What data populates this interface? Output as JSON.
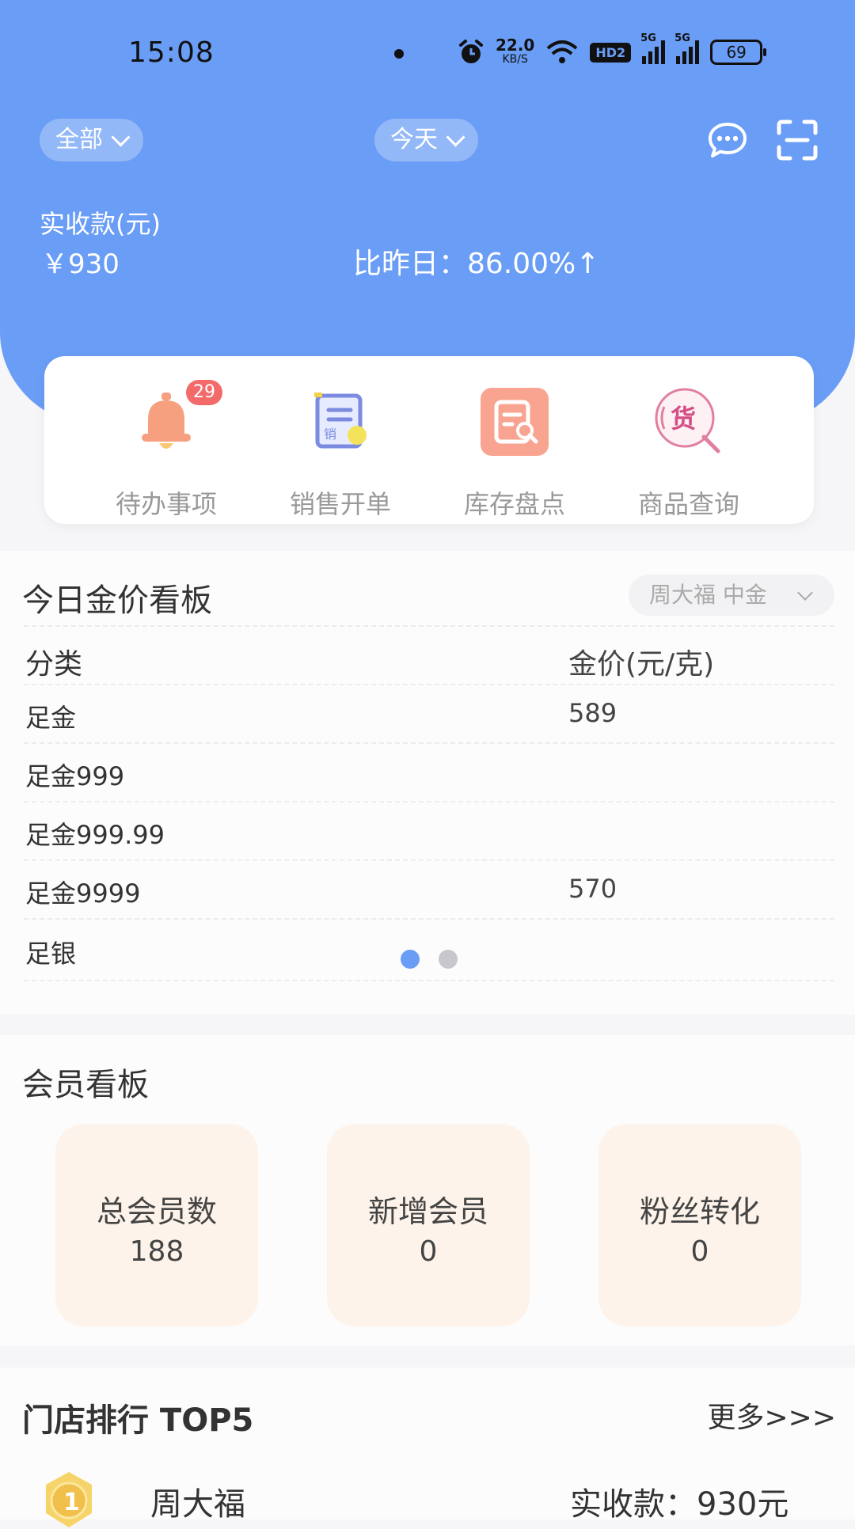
{
  "status_bar": {
    "time": "15:08",
    "net_speed": "22.0",
    "net_unit": "KB/S",
    "hd_label": "HD2",
    "signal_1": "5G",
    "signal_2": "5G",
    "battery": "69"
  },
  "header": {
    "filter_scope": "全部",
    "filter_date": "今天",
    "icons": [
      "chat-bubble-icon",
      "scan-icon"
    ],
    "revenue_label": "实收款(元)",
    "revenue_value": "￥930",
    "compare_text": "比昨日：86.00%↑",
    "accent_color": "#6a9df5"
  },
  "quick_actions": [
    {
      "label": "待办事项",
      "icon": "bell-icon",
      "badge": "29"
    },
    {
      "label": "销售开单",
      "icon": "sales-order-icon"
    },
    {
      "label": "库存盘点",
      "icon": "inventory-check-icon"
    },
    {
      "label": "商品查询",
      "icon": "goods-search-icon"
    }
  ],
  "gold_board": {
    "title": "今日金价看板",
    "brand_selected": "周大福 中金",
    "columns": [
      "分类",
      "金价(元/克)"
    ],
    "rows": [
      {
        "category": "足金",
        "price": "589"
      },
      {
        "category": "足金999",
        "price": ""
      },
      {
        "category": "足金999.99",
        "price": ""
      },
      {
        "category": "足金9999",
        "price": "570"
      },
      {
        "category": "足银",
        "price": ""
      }
    ],
    "pager": {
      "pages": 2,
      "current": 1
    }
  },
  "member_board": {
    "title": "会员看板",
    "cards": [
      {
        "label": "总会员数",
        "value": "188"
      },
      {
        "label": "新增会员",
        "value": "0"
      },
      {
        "label": "粉丝转化",
        "value": "0"
      }
    ]
  },
  "store_ranking": {
    "title": "门店排行 TOP5",
    "more_label": "更多>>>",
    "rows": [
      {
        "rank": "1",
        "name": "周大福",
        "amount": "实收款：930元"
      }
    ]
  }
}
